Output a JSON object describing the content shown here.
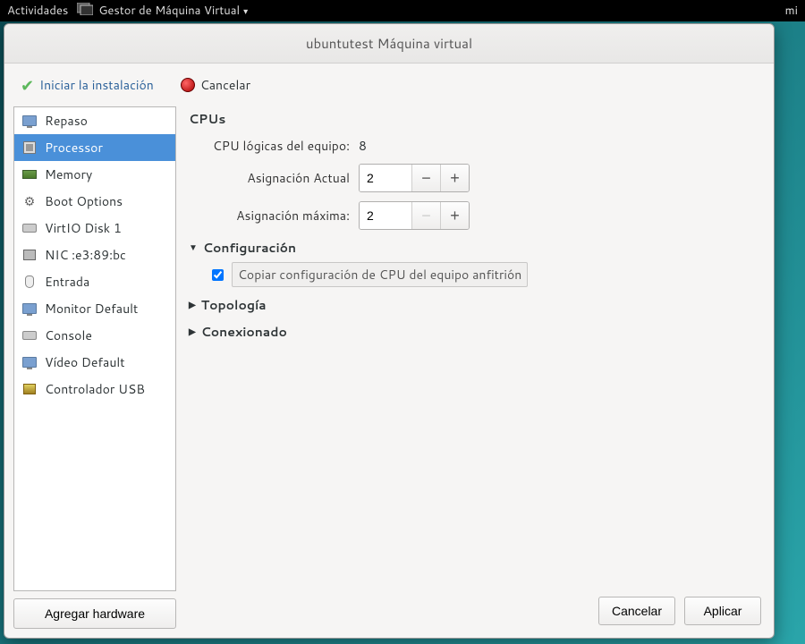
{
  "topbar": {
    "activities": "Actividades",
    "app_name": "Gestor de Máquina Virtual",
    "right_text": "mi"
  },
  "window": {
    "title": "ubuntutest Máquina virtual"
  },
  "toolbar": {
    "install_label": "Iniciar la instalación",
    "cancel_label": "Cancelar"
  },
  "sidebar": {
    "items": [
      {
        "label": "Repaso",
        "icon": "monitor"
      },
      {
        "label": "Processor",
        "icon": "cpu",
        "selected": true
      },
      {
        "label": "Memory",
        "icon": "mem"
      },
      {
        "label": "Boot Options",
        "icon": "gear"
      },
      {
        "label": "VirtIO Disk 1",
        "icon": "disk"
      },
      {
        "label": "NIC :e3:89:bc",
        "icon": "nic"
      },
      {
        "label": "Entrada",
        "icon": "mouse"
      },
      {
        "label": "Monitor Default",
        "icon": "monitor"
      },
      {
        "label": "Console",
        "icon": "disk"
      },
      {
        "label": "Vídeo Default",
        "icon": "monitor"
      },
      {
        "label": "Controlador USB",
        "icon": "usb"
      }
    ],
    "add_hw": "Agregar hardware"
  },
  "cpu": {
    "heading": "CPUs",
    "logical_label": "CPU lógicas del equipo:",
    "logical_value": "8",
    "current_label": "Asignación Actual",
    "current_value": "2",
    "max_label": "Asignación máxima:",
    "max_value": "2",
    "config_heading": "Configuración",
    "copy_host_label": "Copiar configuración de CPU del equipo anfitrión",
    "copy_host_checked": true,
    "topology_heading": "Topología",
    "connections_heading": "Conexionado"
  },
  "footer": {
    "cancel": "Cancelar",
    "apply": "Aplicar"
  }
}
